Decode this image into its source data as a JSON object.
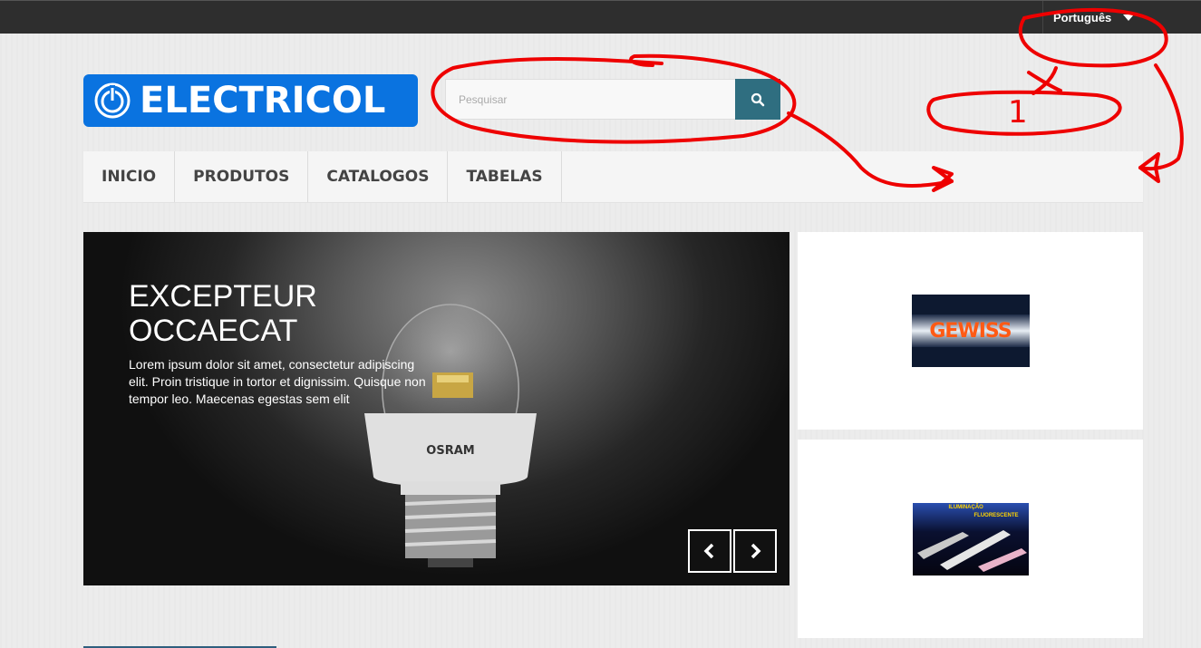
{
  "header": {
    "language_label": "Português",
    "logo_text": "ELECTRICOL"
  },
  "search": {
    "placeholder": "Pesquisar"
  },
  "nav": {
    "items": [
      {
        "label": "INICIO"
      },
      {
        "label": "PRODUTOS"
      },
      {
        "label": "CATALOGOS"
      },
      {
        "label": "TABELAS"
      }
    ]
  },
  "slider": {
    "title": "EXCEPTEUR OCCAECAT",
    "text": "Lorem ipsum dolor sit amet, consectetur adipiscing elit. Proin tristique in tortor et dignissim. Quisque non tempor leo. Maecenas egestas sem elit",
    "bulb_brand": "OSRAM"
  },
  "side_cards": {
    "brand1": "GEWISS",
    "brand2_line1": "ILUMINAÇÃO",
    "brand2_line2": "FLUORESCENTE"
  },
  "annotation": {
    "mark": "1",
    "color": "#ee0000"
  },
  "colors": {
    "topbar": "#2e2e2e",
    "logo_blue": "#0a73e0",
    "search_button": "#2f6e80"
  }
}
